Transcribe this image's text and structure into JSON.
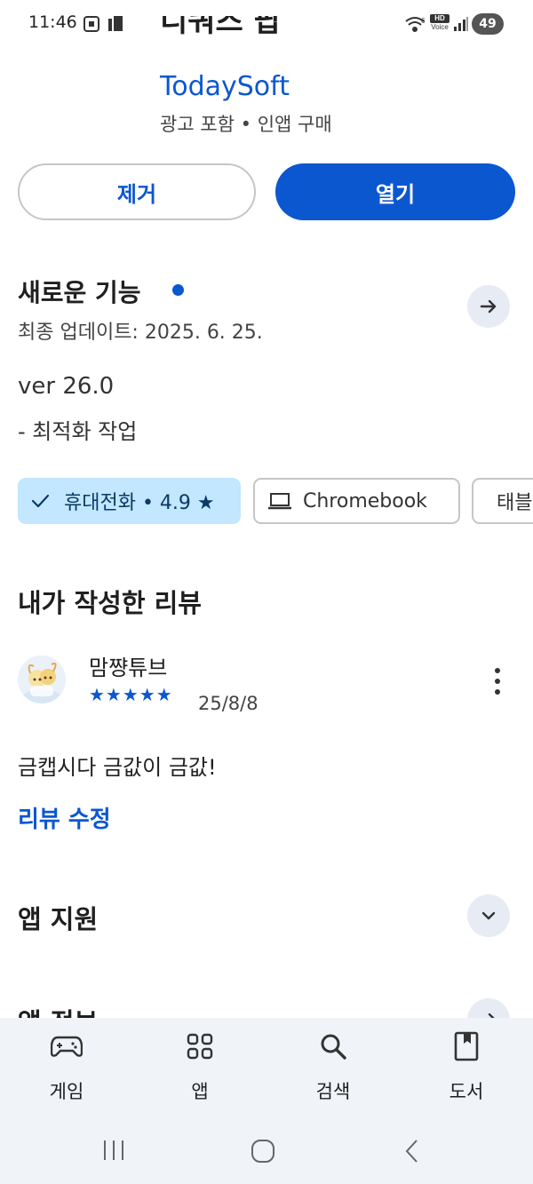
{
  "status_bar": {
    "time": "11:46",
    "battery": "49",
    "hd_label": "HD",
    "voice_label": "Voice",
    "wifi_label": "6"
  },
  "header": {
    "app_name": "디쿼즈 팝",
    "developer": "TodaySoft",
    "ad_info": "광고 포함 • 인앱 구매"
  },
  "actions": {
    "uninstall_label": "제거",
    "open_label": "열기"
  },
  "whats_new": {
    "title": "새로운 기능",
    "last_updated": "최종 업데이트: 2025. 6. 25.",
    "version": "ver 26.0",
    "note": "- 최적화 작업"
  },
  "device_chips": [
    {
      "label": "휴대전화 • 4.9 ★",
      "selected": true
    },
    {
      "label": "Chromebook",
      "selected": false
    },
    {
      "label": "태블릿",
      "selected": false
    }
  ],
  "my_review": {
    "title": "내가 작성한 리뷰",
    "reviewer": "맘쨩튜브",
    "stars": "★★★★★",
    "rating": 5,
    "date": "25/8/8",
    "text": "금캡시다 금값이 금값!",
    "edit_label": "리뷰 수정"
  },
  "app_support": {
    "title": "앱 지원"
  },
  "app_info": {
    "title": "앱 정보"
  },
  "bottom_nav": [
    {
      "label": "게임",
      "icon": "gamepad-icon"
    },
    {
      "label": "앱",
      "icon": "apps-grid-icon"
    },
    {
      "label": "검색",
      "icon": "search-icon"
    },
    {
      "label": "도서",
      "icon": "book-icon"
    }
  ],
  "colors": {
    "accent": "#0b57d0",
    "chip_selected_bg": "#c2e7ff",
    "nav_bg": "#f0f3f8"
  }
}
